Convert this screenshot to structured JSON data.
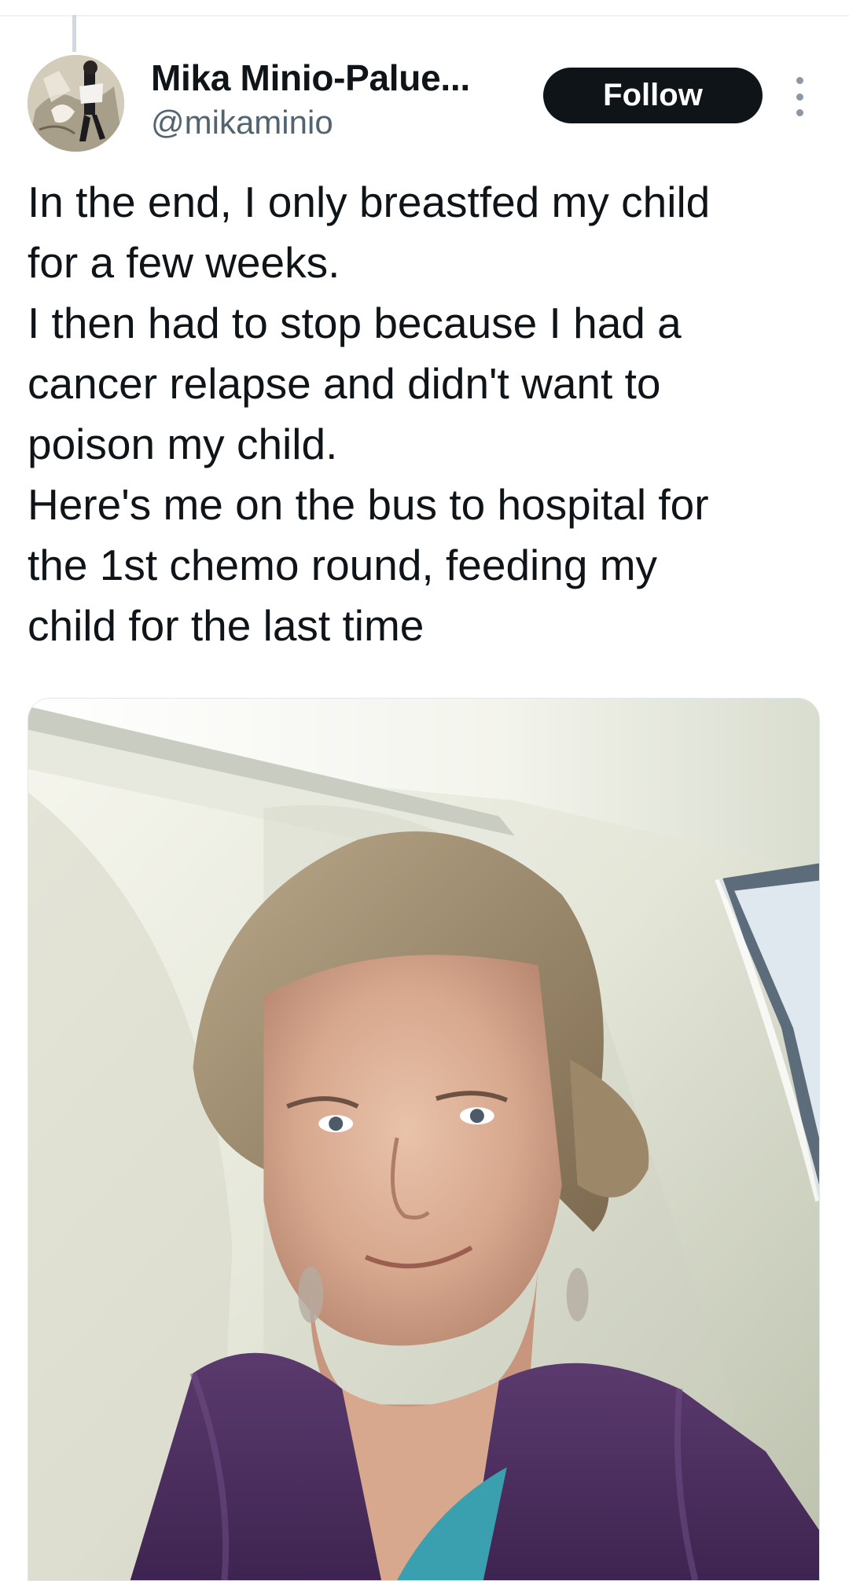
{
  "author": {
    "display_name": "Mika Minio-Palue...",
    "handle": "@mikaminio"
  },
  "actions": {
    "follow_label": "Follow",
    "more_icon": "more-vertical-icon"
  },
  "tweet": {
    "lines": [
      "In the end, I only breastfed my child",
      "for a few weeks.",
      "I then had to stop because I had a",
      "cancer relapse and didn't want to",
      "poison my child.",
      "Here's me on the bus to hospital for",
      "the 1st chemo round, feeding my",
      "child for the last time"
    ]
  },
  "colors": {
    "follow_bg": "#0f1419",
    "text": "#0f1419",
    "handle": "#536471"
  }
}
